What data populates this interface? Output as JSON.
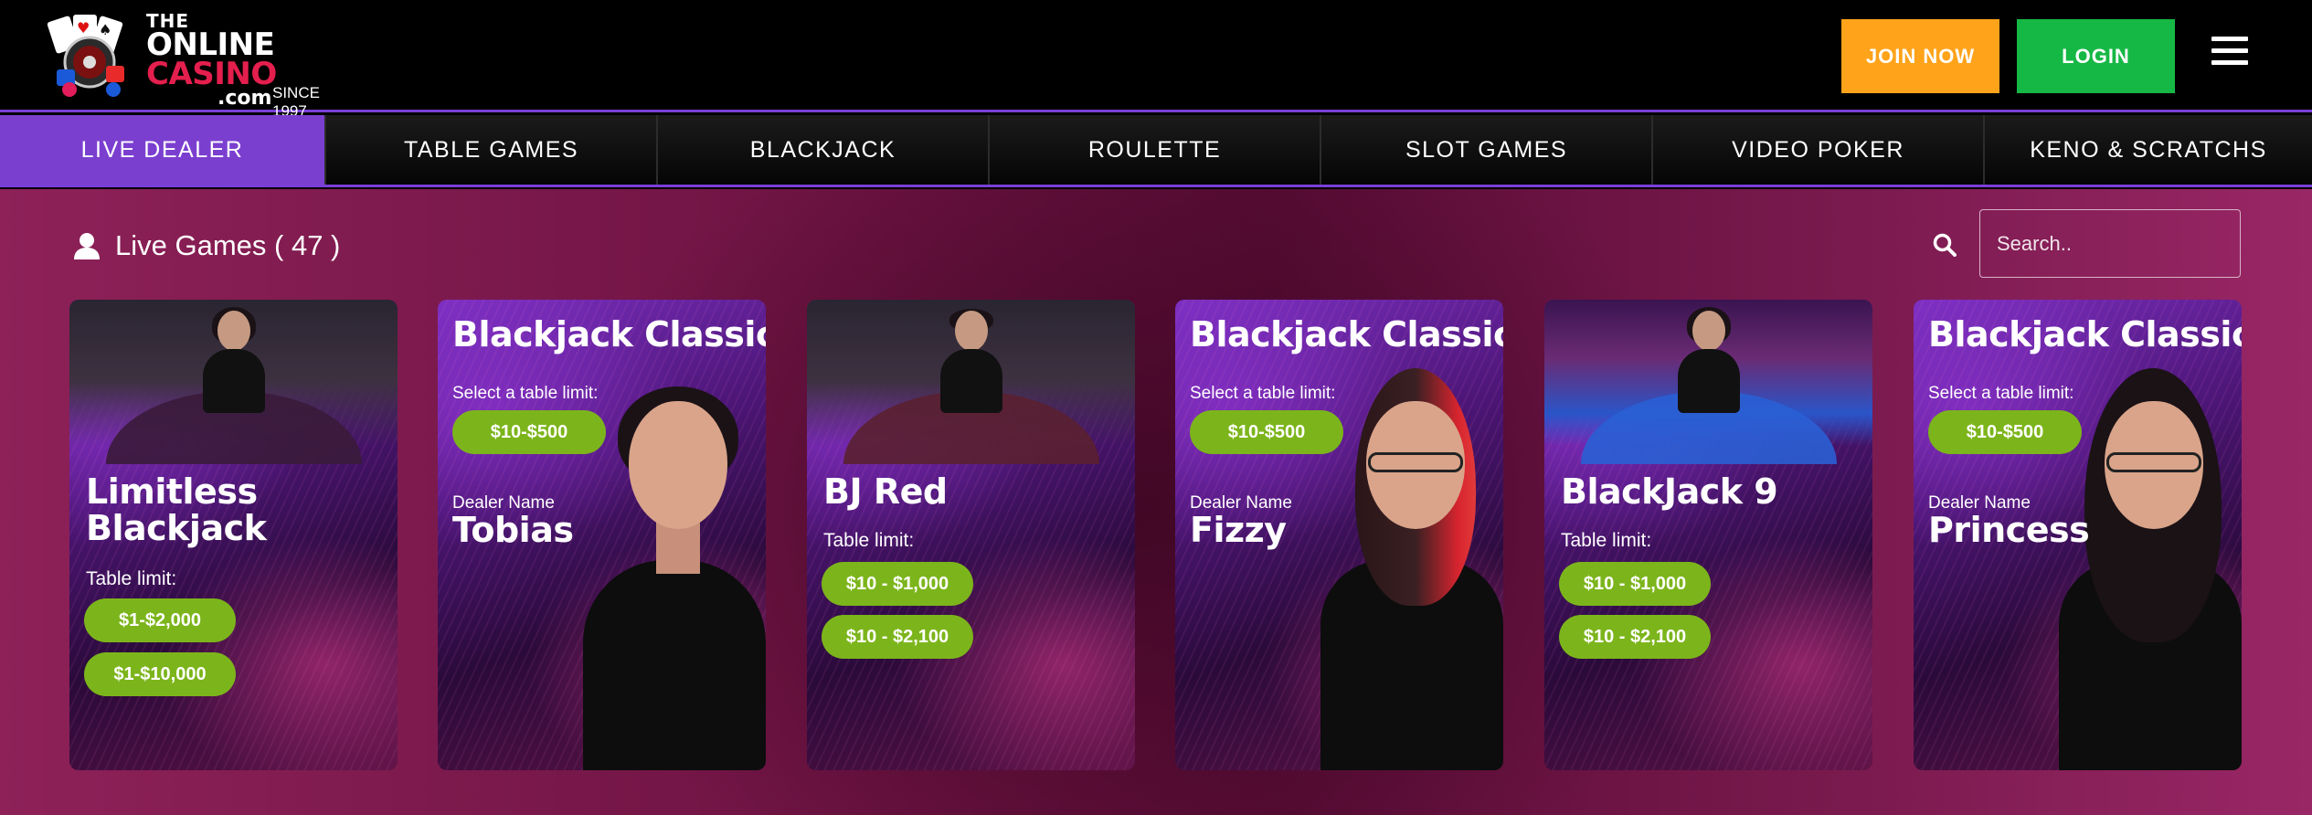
{
  "header": {
    "logo": {
      "line1": "THE",
      "line2": "ONLINE",
      "line3": "CASINO",
      "line4": ".com",
      "since": "SINCE 1997"
    },
    "join_label": "JOIN NOW",
    "login_label": "LOGIN",
    "colors": {
      "join": "#ffa31a",
      "login": "#16b845",
      "accent": "#7b3fd0"
    }
  },
  "nav": {
    "items": [
      {
        "label": "LIVE DEALER",
        "active": true
      },
      {
        "label": "TABLE GAMES"
      },
      {
        "label": "BLACKJACK"
      },
      {
        "label": "ROULETTE"
      },
      {
        "label": "SLOT GAMES"
      },
      {
        "label": "VIDEO POKER"
      },
      {
        "label": "KENO & SCRATCHS"
      }
    ]
  },
  "section": {
    "title": "Live Games ( 47 )",
    "search_placeholder": "Search.."
  },
  "cards": [
    {
      "kind": "game",
      "name_line1": "Limitless",
      "name_line2": "Blackjack",
      "table_label": "Table limit:",
      "limits": [
        "$1-$2,000",
        "$1-$10,000"
      ]
    },
    {
      "kind": "dealer",
      "title": "Blackjack Classic",
      "select_label": "Select a table limit:",
      "limit": "$10-$500",
      "dealer_label": "Dealer Name",
      "dealer": "Tobias"
    },
    {
      "kind": "game",
      "name_line1": "BJ Red",
      "table_label": "Table limit:",
      "limits": [
        "$10 - $1,000",
        "$10 - $2,100"
      ]
    },
    {
      "kind": "dealer",
      "title": "Blackjack Classic",
      "select_label": "Select a table limit:",
      "limit": "$10-$500",
      "dealer_label": "Dealer Name",
      "dealer": "Fizzy"
    },
    {
      "kind": "game",
      "name_line1": "BlackJack 9",
      "table_label": "Table limit:",
      "limits": [
        "$10 - $1,000",
        "$10 - $2,100"
      ]
    },
    {
      "kind": "dealer",
      "title": "Blackjack Classic",
      "select_label": "Select a table limit:",
      "limit": "$10-$500",
      "dealer_label": "Dealer Name",
      "dealer": "Princess"
    }
  ]
}
